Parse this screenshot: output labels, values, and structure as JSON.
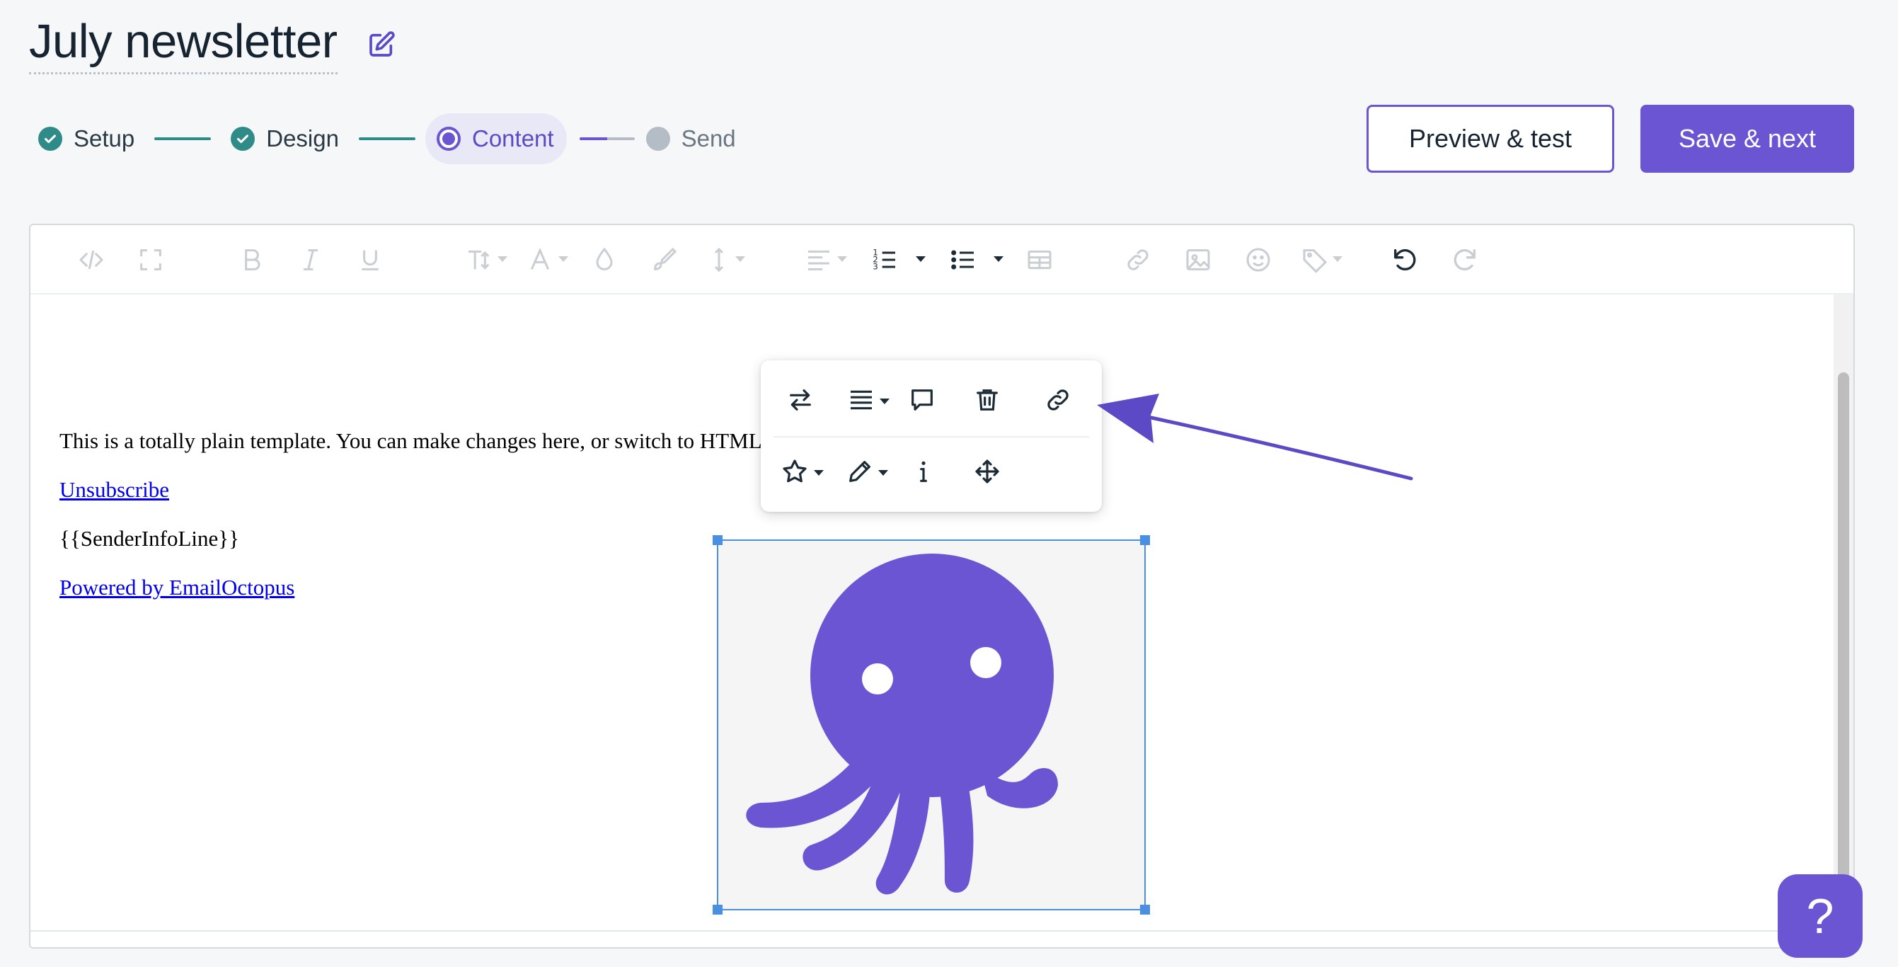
{
  "header": {
    "title": "July newsletter",
    "edit_icon": "pencil-square-icon"
  },
  "steps": [
    {
      "label": "Setup",
      "state": "done"
    },
    {
      "label": "Design",
      "state": "done"
    },
    {
      "label": "Content",
      "state": "current"
    },
    {
      "label": "Send",
      "state": "todo"
    }
  ],
  "actions": {
    "preview_label": "Preview & test",
    "save_label": "Save & next"
  },
  "toolbar": {
    "icons": [
      "code-view-icon",
      "fullscreen-icon",
      "bold-icon",
      "italic-icon",
      "underline-icon",
      "font-size-icon",
      "font-color-icon",
      "background-color-icon",
      "paint-format-icon",
      "line-height-icon",
      "align-icon",
      "ordered-list-icon",
      "unordered-list-icon",
      "table-icon",
      "link-icon",
      "image-icon",
      "emoji-icon",
      "tag-icon",
      "undo-icon",
      "redo-icon"
    ]
  },
  "content": {
    "intro": "This is a totally plain template. You can make changes here, or switch to HTML view by clicking the </> button.",
    "unsubscribe": "Unsubscribe",
    "sender_info": "{{SenderInfoLine}}",
    "powered_by": "Powered by EmailOctopus"
  },
  "image_popup": {
    "row1": [
      "replace-icon",
      "align-icon",
      "comment-icon",
      "delete-icon",
      "link-icon"
    ],
    "row2": [
      "style-icon",
      "edit-icon",
      "alt-text-icon",
      "move-icon"
    ]
  },
  "colors": {
    "accent": "#6b55d3",
    "done": "#2e8b87",
    "pending": "#b4bcc6"
  },
  "help": {
    "label": "?"
  }
}
